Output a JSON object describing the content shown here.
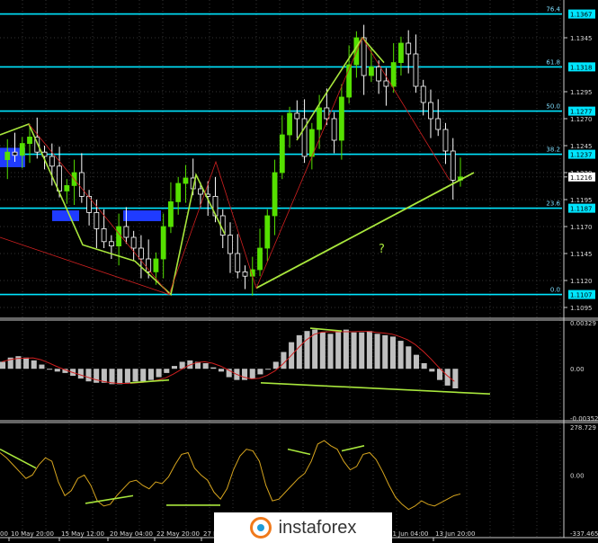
{
  "chart_data": [
    {
      "type": "candlestick",
      "title": "",
      "y_ticks": [
        "1.1367",
        "1.1345",
        "1.1318",
        "1.1295",
        "1.1277",
        "1.1270",
        "1.1245",
        "1.1237",
        "1.1220",
        "1.1216",
        "1.1195",
        "1.1187",
        "1.1170",
        "1.1145",
        "1.1120",
        "1.1107",
        "1.1095"
      ],
      "ylim": [
        1.1085,
        1.138
      ],
      "current_price": "1.1216",
      "fib_levels": [
        {
          "label": "76.4",
          "value": "1.1367"
        },
        {
          "label": "61.8",
          "value": "1.1318"
        },
        {
          "label": "50.0",
          "value": "1.1277"
        },
        {
          "label": "38.2",
          "value": "1.1237"
        },
        {
          "label": "23.6",
          "value": "1.1187"
        },
        {
          "label": "0.0",
          "value": "1.1107"
        }
      ],
      "annotation": "?",
      "series": [
        {
          "values": [
            1.1232,
            1.1239,
            1.1236,
            1.1247,
            1.1253,
            1.1239,
            1.1235,
            1.1226,
            1.1203,
            1.1208,
            1.122,
            1.1198,
            1.1183,
            1.1168,
            1.1156,
            1.1152,
            1.117,
            1.116,
            1.115,
            1.114,
            1.1128,
            1.114,
            1.117,
            1.1193,
            1.121,
            1.1215,
            1.1205,
            1.12,
            1.1198,
            1.118,
            1.1162,
            1.1145,
            1.1128,
            1.1124,
            1.113,
            1.115,
            1.118,
            1.122,
            1.1255,
            1.1275,
            1.127,
            1.1235,
            1.126,
            1.128,
            1.127,
            1.125,
            1.129,
            1.132,
            1.1345,
            1.131,
            1.1318,
            1.1305,
            1.13,
            1.1322,
            1.134,
            1.133,
            1.13,
            1.1285,
            1.127,
            1.126,
            1.124,
            1.1213,
            1.1216
          ]
        }
      ]
    },
    {
      "type": "bar",
      "title": "",
      "y_ticks": [
        "0.00329",
        "0.00",
        "-0.00352"
      ],
      "ylim": [
        -0.00352,
        0.00329
      ],
      "series": [
        {
          "values": [
            0.0005,
            0.0008,
            0.0009,
            0.0008,
            0.0006,
            0.0003,
            0.0,
            -0.0002,
            -0.0003,
            -0.0005,
            -0.0007,
            -0.0009,
            -0.001,
            -0.001,
            -0.0011,
            -0.0011,
            -0.001,
            -0.0009,
            -0.0009,
            -0.0008,
            -0.0006,
            -0.0003,
            0.0002,
            0.0005,
            0.0006,
            0.0005,
            0.0004,
            0.0001,
            -0.0002,
            -0.0006,
            -0.0008,
            -0.0008,
            -0.0007,
            -0.0004,
            0.0,
            0.0005,
            0.0012,
            0.0019,
            0.0024,
            0.0027,
            0.0028,
            0.0026,
            0.0025,
            0.0027,
            0.0028,
            0.0026,
            0.0026,
            0.0027,
            0.0025,
            0.0024,
            0.0023,
            0.002,
            0.0016,
            0.001,
            0.0004,
            -0.0002,
            -0.0008,
            -0.0012,
            -0.0014
          ]
        }
      ]
    },
    {
      "type": "line",
      "title": "",
      "y_ticks": [
        "278.729",
        "0.00",
        "-337.465"
      ],
      "ylim": [
        -337.465,
        278.729
      ],
      "series": [
        {
          "values": [
            130,
            100,
            60,
            20,
            -20,
            0,
            60,
            100,
            80,
            -40,
            -120,
            -90,
            -20,
            0,
            -60,
            -150,
            -180,
            -170,
            -120,
            -80,
            -40,
            -30,
            -60,
            -80,
            -40,
            -50,
            -10,
            60,
            120,
            130,
            40,
            0,
            -30,
            -100,
            -140,
            -80,
            30,
            110,
            150,
            140,
            80,
            -60,
            -150,
            -140,
            -100,
            -60,
            -20,
            10,
            80,
            180,
            200,
            170,
            150,
            80,
            30,
            50,
            120,
            130,
            90,
            20,
            -60,
            -130,
            -170,
            -200,
            -180,
            -150,
            -170,
            -180,
            -160,
            -140,
            -120,
            -110
          ]
        }
      ]
    }
  ],
  "x_ticks": [
    "10 May 20:00",
    "15 May 12:00",
    "20 May 04:00",
    "22 May 20:00",
    "27 Ma",
    "11 Jun 04:00",
    "13 Jun 20:00"
  ],
  "x_tick_left_stub": "00",
  "logo": {
    "text": "instaforex"
  },
  "colors": {
    "background": "#000000",
    "fib": "#00e5ff",
    "trendline": "#a8e63c",
    "signal": "#d02020",
    "histogram": "#bfbfbf",
    "cci": "#d7a51e",
    "candle_up": "#55e000",
    "candle_down": "#ffffff",
    "blue_box": "#1f3bff"
  }
}
